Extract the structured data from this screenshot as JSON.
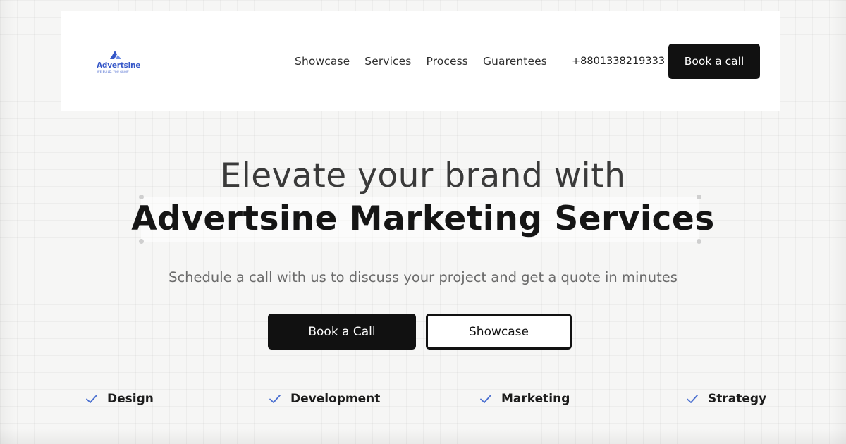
{
  "brand": {
    "name": "Advertsine",
    "tagline": "WE BUILD, YOU GROW",
    "accent": "#3557c8"
  },
  "nav": {
    "items": [
      "Showcase",
      "Services",
      "Process",
      "Guarentees"
    ],
    "phone": "+8801338219333",
    "cta_label": "Book a call"
  },
  "hero": {
    "title_line1": "Elevate your brand with",
    "title_line2": "Advertsine Marketing Services",
    "subtitle": "Schedule a call with us to discuss your project and get a quote in minutes",
    "primary_label": "Book a Call",
    "secondary_label": "Showcase"
  },
  "features": {
    "icon": "check-icon",
    "check_color": "#4a6fd0",
    "items": [
      "Design",
      "Development",
      "Marketing",
      "Strategy"
    ]
  },
  "colors": {
    "background": "#f6f6f5",
    "button_dark": "#111111",
    "text_muted": "#6b6b6b"
  }
}
